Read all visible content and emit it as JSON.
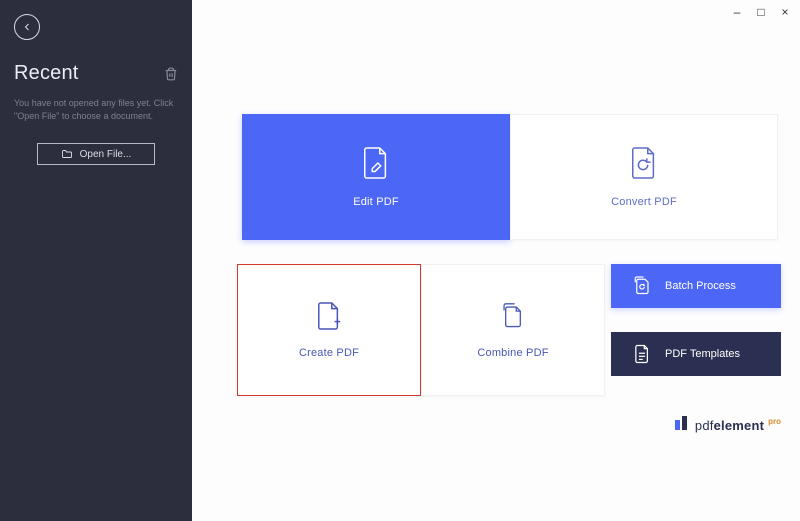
{
  "window": {
    "minimize": "–",
    "maximize": "□",
    "close": "×"
  },
  "sidebar": {
    "recent_title": "Recent",
    "hint": "You have not opened any files yet. Click \"Open File\" to choose a document.",
    "open_file_label": "Open File..."
  },
  "tiles": {
    "edit": "Edit PDF",
    "convert": "Convert PDF",
    "create": "Create PDF",
    "combine": "Combine PDF",
    "batch": "Batch Process",
    "templates": "PDF Templates"
  },
  "brand": {
    "name_light": "pdf",
    "name_bold": "element",
    "suffix": "pro"
  },
  "colors": {
    "accent": "#4c67f6",
    "dark": "#2b3052",
    "sidebar": "#2c2e3e",
    "highlight_border": "#d33a2f"
  }
}
